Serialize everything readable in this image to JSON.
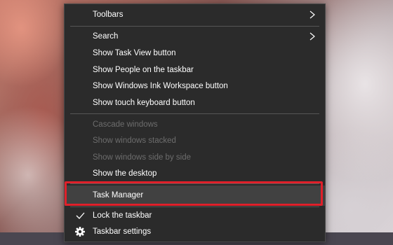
{
  "context_menu": {
    "items": [
      {
        "label": "Toolbars",
        "submenu": true
      },
      {
        "label": "Search",
        "submenu": true
      },
      {
        "label": "Show Task View button"
      },
      {
        "label": "Show People on the taskbar"
      },
      {
        "label": "Show Windows Ink Workspace button"
      },
      {
        "label": "Show touch keyboard button"
      },
      {
        "label": "Cascade windows",
        "disabled": true
      },
      {
        "label": "Show windows stacked",
        "disabled": true
      },
      {
        "label": "Show windows side by side",
        "disabled": true
      },
      {
        "label": "Show the desktop"
      },
      {
        "label": "Task Manager",
        "highlighted": true
      },
      {
        "label": "Lock the taskbar",
        "checked": true
      },
      {
        "label": "Taskbar settings",
        "icon": "gear-icon"
      }
    ]
  },
  "colors": {
    "menu_background": "#2b2b2b",
    "text": "#ffffff",
    "disabled_text": "#6d6d6d",
    "hover_background": "#414141",
    "highlight_border": "#e0202a"
  }
}
